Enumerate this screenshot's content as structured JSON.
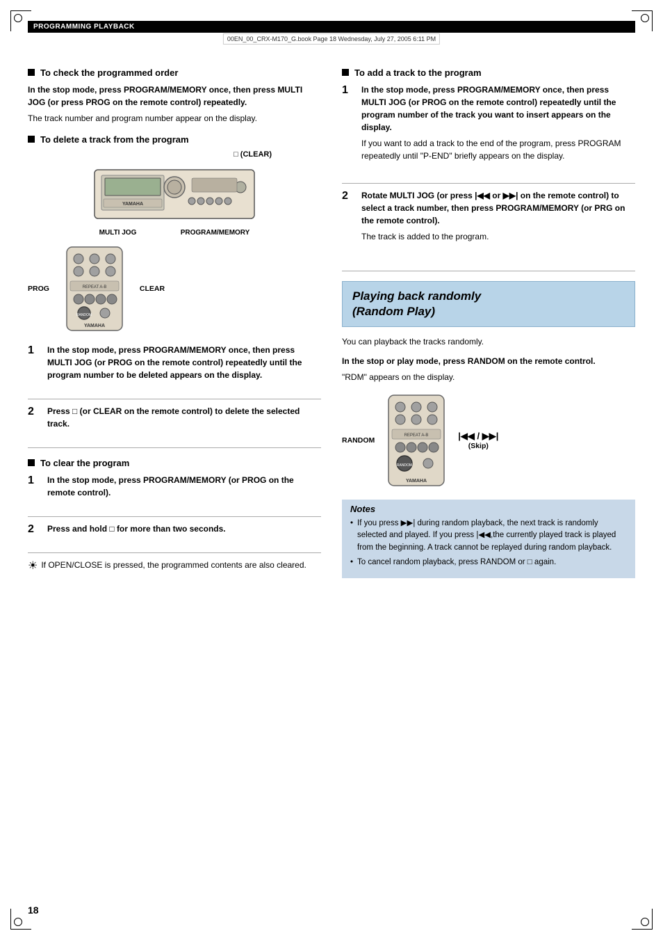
{
  "header": {
    "title": "PROGRAMMING PLAYBACK"
  },
  "fileinfo": {
    "text": "00EN_00_CRX-M170_G.book  Page 18  Wednesday, July 27, 2005  6:11 PM"
  },
  "page": {
    "number": "18"
  },
  "left": {
    "sections": [
      {
        "heading": "To check the programmed order",
        "bold_text": "In the stop mode, press PROGRAM/MEMORY once, then press MULTI JOG (or press PROG on the remote control) repeatedly.",
        "normal_text": "The track number and program number appear on the display."
      },
      {
        "heading": "To delete a track from the program",
        "diagram": {
          "label_clear_top": "□ (CLEAR)",
          "label_multi_jog": "MULTI JOG",
          "label_program_memory": "PROGRAM/MEMORY",
          "label_prog": "PROG",
          "label_clear_right": "CLEAR"
        }
      },
      {
        "heading": "To clear the program"
      }
    ],
    "delete_steps": [
      {
        "bold_text": "In the stop mode, press PROGRAM/MEMORY once, then press MULTI JOG (or PROG on the remote control) repeatedly until the program number to be deleted appears on the display."
      },
      {
        "bold_text": "Press □  (or CLEAR on the remote control) to delete the selected track."
      }
    ],
    "clear_steps": [
      {
        "bold_text": "In the stop mode, press PROGRAM/MEMORY (or PROG on the remote control)."
      },
      {
        "bold_text": "Press and hold □  for more than two seconds."
      }
    ],
    "clear_note": "If OPEN/CLOSE is pressed, the programmed contents are also cleared."
  },
  "right": {
    "sections": [
      {
        "heading": "To add a track to the program"
      }
    ],
    "add_steps": [
      {
        "bold_text": "In the stop mode, press PROGRAM/MEMORY once, then press MULTI JOG (or PROG on the remote control) repeatedly until the program number of the track you want to insert appears on the display.",
        "normal_text": "If you want to add a track to the end of the program, press PROGRAM repeatedly until \"P-END\" briefly appears on the display."
      },
      {
        "bold_text": "Rotate MULTI JOG (or press |◀◀ or ▶▶|  on the remote control) to select a track number, then press PROGRAM/MEMORY (or PRG on the remote control).",
        "normal_text": "The track is added to the program."
      }
    ],
    "random_play": {
      "title_line1": "Playing back randomly",
      "title_line2": "(Random Play)",
      "intro": "You can playback the tracks randomly.",
      "instruction": "In the stop or play mode, press RANDOM on the remote control.",
      "rdm_note": "\"RDM\" appears on the display.",
      "diagram": {
        "label_random": "RANDOM",
        "label_skip": "(Skip)"
      }
    },
    "notes": {
      "title": "Notes",
      "items": [
        "If you press ▶▶| during random playback, the next track is randomly selected and played. If you press |◀◀,the currently played track is played from the beginning. A track cannot be replayed during random playback.",
        "To cancel random playback, press RANDOM or □  again."
      ]
    }
  }
}
